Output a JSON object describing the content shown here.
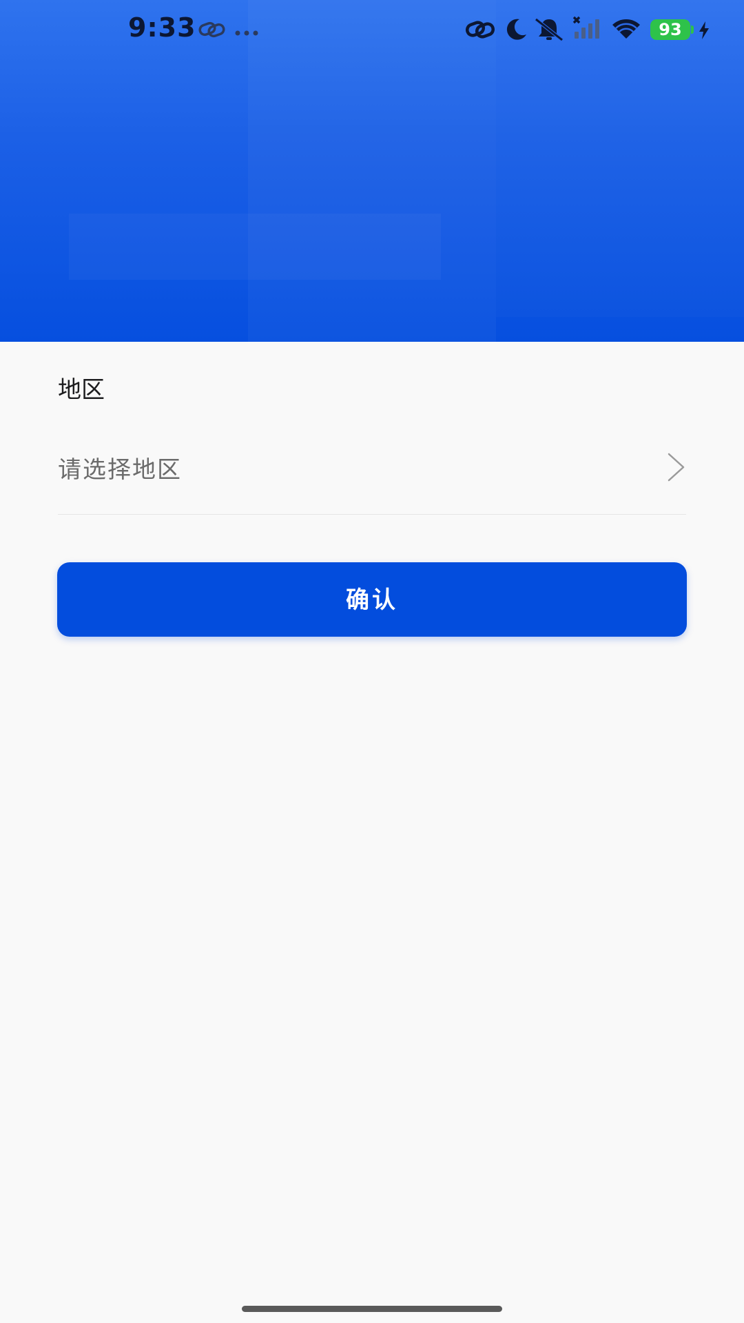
{
  "status_bar": {
    "time": "9:33",
    "battery_level": "93",
    "icons": [
      "link-icon",
      "more-dots-icon",
      "link-icon",
      "moon-icon",
      "mute-bell-icon",
      "no-signal-icon",
      "wifi-icon",
      "battery-icon",
      "charging-icon"
    ]
  },
  "form": {
    "region_label": "地区",
    "region_placeholder": "请选择地区",
    "confirm_label": "确认"
  },
  "colors": {
    "header_blue_top": "#2f73ee",
    "header_blue_bottom": "#064fdf",
    "button_blue": "#034ddd",
    "battery_green": "#2ec24a",
    "background": "#f9f9f9"
  }
}
